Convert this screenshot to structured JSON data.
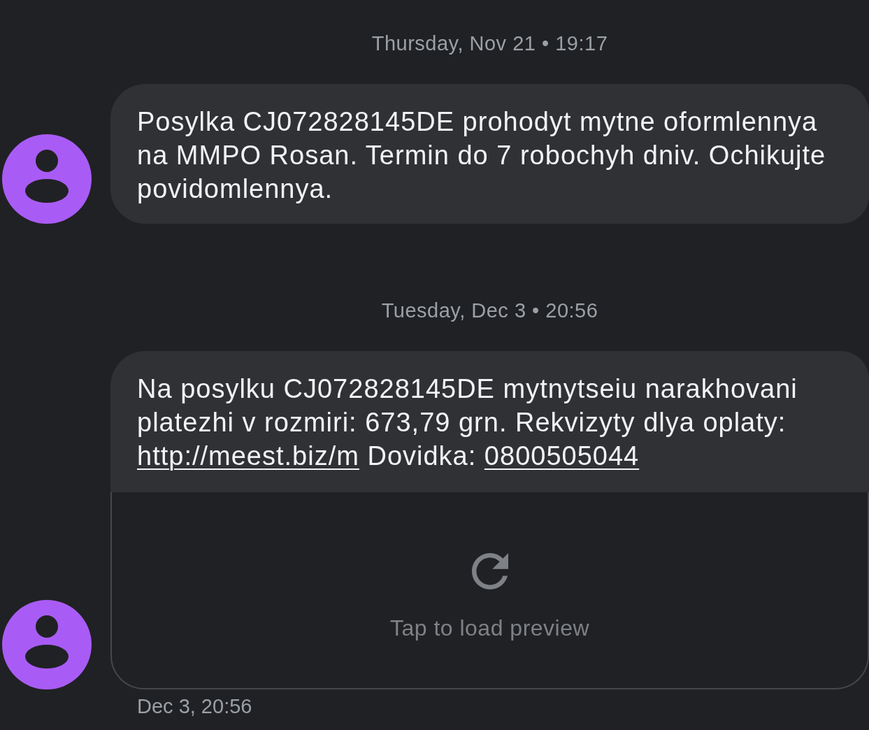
{
  "thread": [
    {
      "kind": "date",
      "text": "Thursday, Nov 21 • 19:17"
    },
    {
      "kind": "message",
      "parts": [
        {
          "kind": "text",
          "text": "Posylka CJ072828145DE prohodyt mytne oformlennya na MMPO Rosan. Termin do 7 robochyh dniv. Ochikujte povidomlennya."
        }
      ]
    },
    {
      "kind": "date",
      "text": "Tuesday, Dec 3 • 20:56"
    },
    {
      "kind": "message",
      "parts": [
        {
          "kind": "text",
          "text": "Na posylku CJ072828145DE mytnytseiu narakhovani platezhi v rozmiri: 673,79 grn. Rekvizyty dlya oplaty: "
        },
        {
          "kind": "link",
          "text": "http://meest.biz/m"
        },
        {
          "kind": "text",
          "text": " Dovidka: "
        },
        {
          "kind": "link",
          "text": "0800505044"
        }
      ],
      "preview": {
        "label": "Tap to load preview"
      },
      "timestamp": "Dec 3, 20:56"
    }
  ]
}
